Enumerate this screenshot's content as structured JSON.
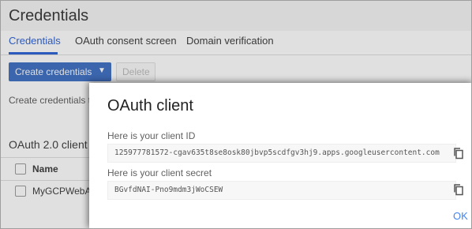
{
  "page": {
    "title": "Credentials",
    "tabs": [
      {
        "label": "Credentials",
        "active": true
      },
      {
        "label": "OAuth consent screen",
        "active": false
      },
      {
        "label": "Domain verification",
        "active": false
      }
    ],
    "create_button": "Create credentials",
    "delete_button": "Delete",
    "description": "Create credentials t",
    "section_title": "OAuth 2.0 client",
    "table": {
      "column_name": "Name",
      "rows": [
        {
          "name": "MyGCPWebA"
        }
      ]
    }
  },
  "dialog": {
    "title": "OAuth client",
    "client_id_label": "Here is your client ID",
    "client_id_value": "125977781572-cgav635t8se8osk80jbvp5scdfgv3hj9.apps.googleusercontent.com",
    "client_secret_label": "Here is your client secret",
    "client_secret_value": "BGvfdNAI-Pno9mdm3jWoCSEW",
    "ok_label": "OK"
  },
  "colors": {
    "accent": "#3367d6",
    "primary_button": "#4473c5",
    "ok_text": "#4285f4"
  },
  "icons": {
    "dropdown": "caret-down-icon",
    "copy": "copy-icon",
    "checkbox": "checkbox-icon"
  }
}
